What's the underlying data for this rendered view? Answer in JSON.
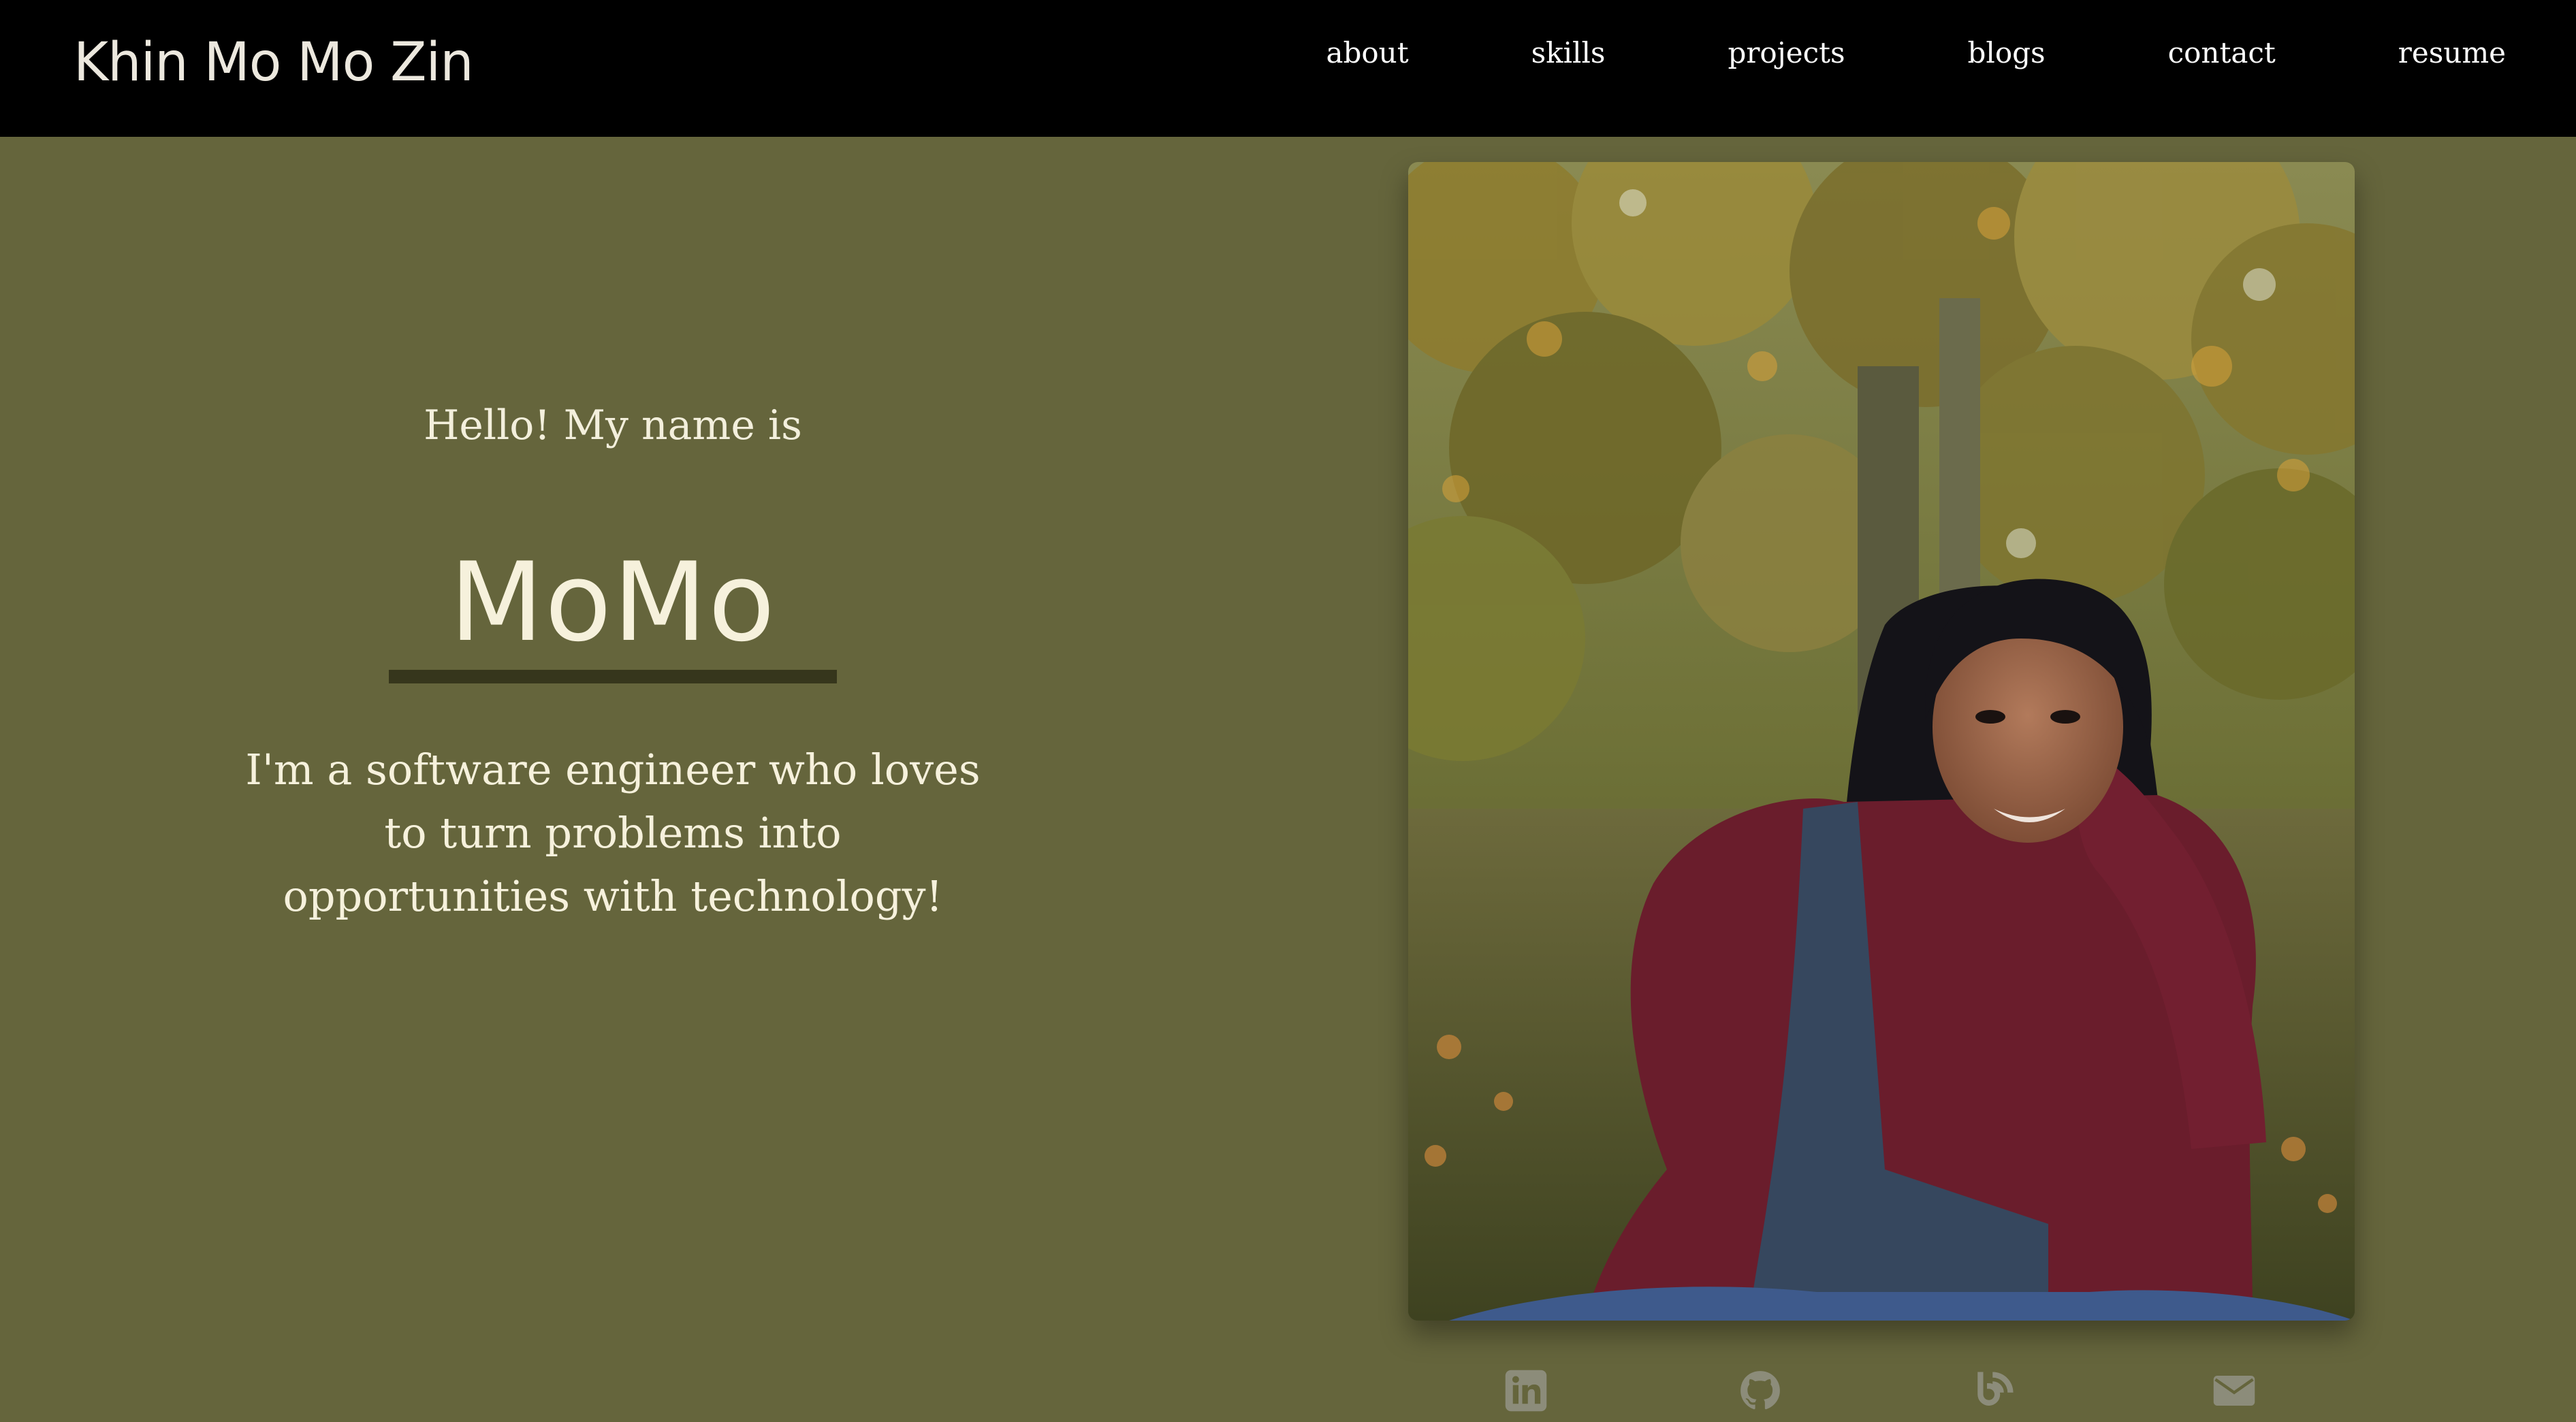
{
  "navbar": {
    "brand": "Khin Mo Mo Zin",
    "links": [
      {
        "label": "about"
      },
      {
        "label": "skills"
      },
      {
        "label": "projects"
      },
      {
        "label": "blogs"
      },
      {
        "label": "contact"
      },
      {
        "label": "resume"
      }
    ]
  },
  "hero": {
    "greeting": "Hello! My name is",
    "name": "MoMo",
    "tagline": "I'm a software engineer who loves to turn problems into opportunities with technology!"
  },
  "social": [
    {
      "icon": "linkedin-icon"
    },
    {
      "icon": "github-icon"
    },
    {
      "icon": "blog-icon"
    },
    {
      "icon": "email-icon"
    }
  ],
  "colors": {
    "background": "#65653c",
    "navbar": "#000000",
    "text": "#f6f1dc",
    "underline": "#36361c",
    "icon": "#8c8c7a"
  }
}
